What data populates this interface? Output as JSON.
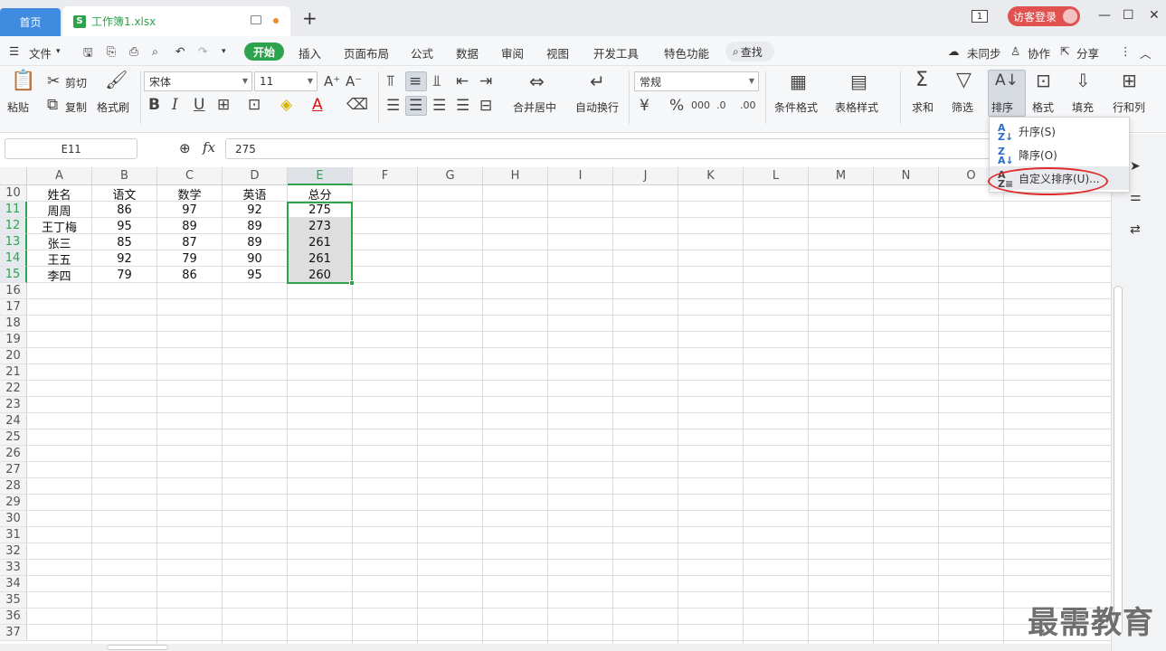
{
  "tabs": {
    "home": "首页",
    "file": "工作簿1.xlsx",
    "file_icon": "S",
    "add": "+",
    "window_count": "1",
    "visitor_login": "访客登录"
  },
  "menu": {
    "file_menu": "文件",
    "items": [
      "开始",
      "插入",
      "页面布局",
      "公式",
      "数据",
      "审阅",
      "视图",
      "开发工具",
      "特色功能"
    ],
    "search": "查找",
    "sync": "未同步",
    "collab": "协作",
    "share": "分享"
  },
  "ribbon": {
    "paste": "粘贴",
    "cut": "剪切",
    "copy": "复制",
    "format_painter": "格式刷",
    "font_name": "宋体",
    "font_size": "11",
    "merge_center": "合并居中",
    "wrap_text": "自动换行",
    "number_format": "常规",
    "conditional_format": "条件格式",
    "table_style": "表格样式",
    "sum": "求和",
    "filter": "筛选",
    "sort": "排序",
    "format": "格式",
    "fill": "填充",
    "row_col": "行和列"
  },
  "formula_bar": {
    "cell_ref": "E11",
    "value": "275"
  },
  "columns": [
    "A",
    "B",
    "C",
    "D",
    "E",
    "F",
    "G",
    "H",
    "I",
    "J",
    "K",
    "L",
    "M",
    "N",
    "O"
  ],
  "rows": [
    "10",
    "11",
    "12",
    "13",
    "14",
    "15",
    "16",
    "17",
    "18",
    "19",
    "20",
    "21",
    "22",
    "23",
    "24",
    "25",
    "26",
    "27",
    "28",
    "29",
    "30",
    "31",
    "32",
    "33",
    "34",
    "35",
    "36",
    "37"
  ],
  "table": [
    [
      "姓名",
      "语文",
      "数学",
      "英语",
      "总分"
    ],
    [
      "周周",
      "86",
      "97",
      "92",
      "275"
    ],
    [
      "王丁梅",
      "95",
      "89",
      "89",
      "273"
    ],
    [
      "张三",
      "85",
      "87",
      "89",
      "261"
    ],
    [
      "王五",
      "92",
      "79",
      "90",
      "261"
    ],
    [
      "李四",
      "79",
      "86",
      "95",
      "260"
    ]
  ],
  "sort_menu": {
    "ascending": "升序(S)",
    "descending": "降序(O)",
    "custom": "自定义排序(U)..."
  },
  "watermark": "最需教育",
  "colors": {
    "accent_green": "#2ea34d",
    "tab_blue": "#3e8bdf",
    "highlight_red": "#e02b2b"
  }
}
